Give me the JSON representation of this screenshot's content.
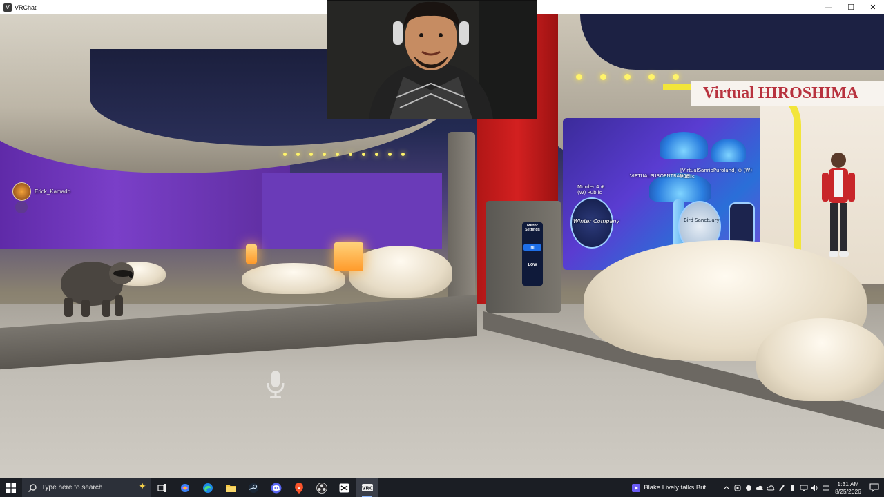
{
  "window": {
    "title": "VRChat",
    "minimize": "—",
    "maximize": "☐",
    "close": "✕"
  },
  "scene": {
    "player_name": "Erick_Kamado",
    "shop_sign": "Virtual HIROSHIMA",
    "mirror": {
      "title": "Mirror Settings",
      "hi_label": "HI",
      "low_label": "LOW"
    },
    "portals": [
      {
        "label": "Murder 4 ⊕ (W) Public"
      },
      {
        "label": "VIRTUALPUROENTRANCE"
      },
      {
        "label": "[VirtualSanrioPuroland] ⊕ (W) Public"
      },
      {
        "label": "Bird Sanctuary"
      }
    ],
    "portal_art_text": "Winter Company"
  },
  "taskbar": {
    "search_placeholder": "Type here to search",
    "apps": [
      {
        "name": "task-view",
        "icon": "task-view-icon"
      },
      {
        "name": "copilot",
        "icon": "copilot-icon"
      },
      {
        "name": "edge",
        "icon": "edge-icon"
      },
      {
        "name": "file-explorer",
        "icon": "folder-icon"
      },
      {
        "name": "steam",
        "icon": "steam-icon"
      },
      {
        "name": "discord",
        "icon": "discord-icon"
      },
      {
        "name": "brave",
        "icon": "brave-icon"
      },
      {
        "name": "obs",
        "icon": "obs-icon"
      },
      {
        "name": "capcut",
        "icon": "capcut-icon"
      },
      {
        "name": "vrchat",
        "icon": "vrchat-icon",
        "active": true
      }
    ],
    "news_text": "Blake Lively talks Brit...",
    "time": "1:31 AM",
    "date": "8/25/2026"
  },
  "colors": {
    "taskbar_bg": "#1b1e24",
    "accent": "#8ab4f8",
    "mirror_hi": "#1e6fe8",
    "shop_sign_text": "#b8323e"
  }
}
